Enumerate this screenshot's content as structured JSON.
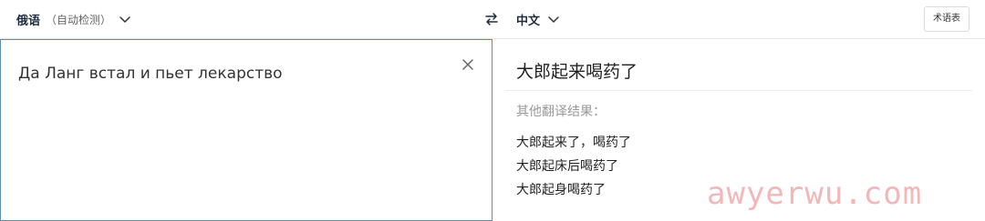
{
  "header": {
    "source_language": "俄语",
    "source_detect_note": "（自动检测）",
    "target_language": "中文",
    "glossary_label": "术语表"
  },
  "icons": {
    "source_dropdown": "chevron-down-icon",
    "target_dropdown": "chevron-down-icon",
    "swap": "swap-arrows-icon",
    "clear": "close-icon"
  },
  "source": {
    "text": "Да Ланг встал и пьет лекарство"
  },
  "result": {
    "main_translation": "大郎起来喝药了",
    "alternatives_title": "其他翻译结果：",
    "alternatives": [
      "大郎起来了，喝药了",
      "大郎起床后喝药了",
      "大郎起身喝药了"
    ]
  },
  "watermark": "awyerwu.com",
  "colors": {
    "panel_border": "#5b8fb0",
    "watermark": "#f0a0a0",
    "muted_text": "#999999"
  }
}
